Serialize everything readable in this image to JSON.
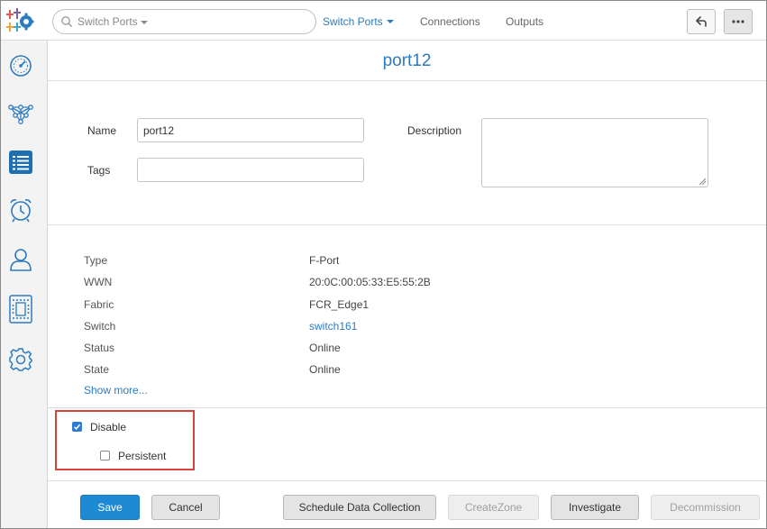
{
  "header": {
    "search_placeholder": "Switch Ports",
    "nav": {
      "switch_ports": "Switch Ports",
      "connections": "Connections",
      "outputs": "Outputs"
    },
    "icons": [
      "logo-icon",
      "search-icon",
      "back-icon",
      "more-icon"
    ]
  },
  "sidebar": {
    "items": [
      "dashboard-icon",
      "topology-icon",
      "list-icon",
      "alarm-icon",
      "user-icon",
      "device-icon",
      "settings-icon"
    ],
    "active_index": 2
  },
  "page": {
    "title": "port12"
  },
  "form": {
    "name_label": "Name",
    "name_value": "port12",
    "tags_label": "Tags",
    "tags_value": "",
    "description_label": "Description",
    "description_value": ""
  },
  "properties": [
    {
      "label": "Type",
      "value": "F-Port"
    },
    {
      "label": "WWN",
      "value": "20:0C:00:05:33:E5:55:2B"
    },
    {
      "label": "Fabric",
      "value": "FCR_Edge1"
    },
    {
      "label": "Switch",
      "value": "switch161"
    },
    {
      "label": "Status",
      "value": "Online"
    },
    {
      "label": "State",
      "value": "Online"
    }
  ],
  "show_more": "Show more...",
  "options": {
    "disable_label": "Disable",
    "disable_checked": true,
    "persistent_label": "Persistent",
    "persistent_checked": false
  },
  "buttons": {
    "save": "Save",
    "cancel": "Cancel",
    "schedule": "Schedule Data Collection",
    "create_zone": "CreateZone",
    "investigate": "Investigate",
    "decommission": "Decommission"
  },
  "colors": {
    "accent": "#2c7bc0",
    "primary_button": "#1f8ad4",
    "highlight_border": "#d9413b"
  }
}
